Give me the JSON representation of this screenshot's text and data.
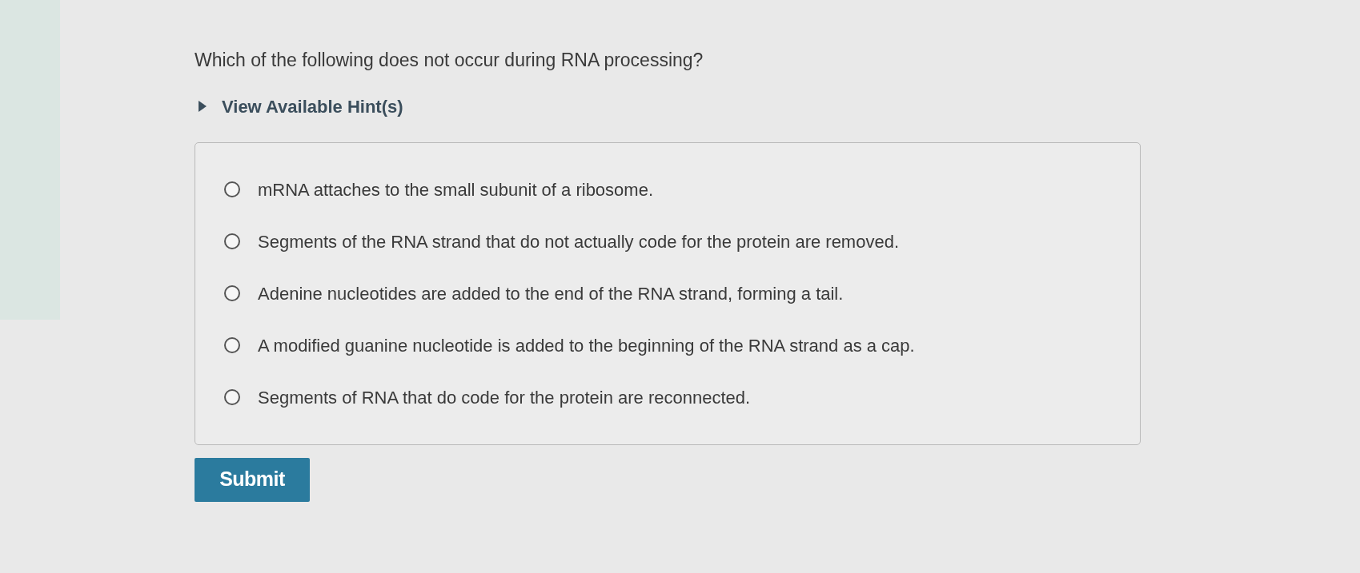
{
  "question": "Which of the following does not occur during RNA processing?",
  "hint": {
    "label": "View Available Hint(s)",
    "expanded": false
  },
  "options": [
    {
      "text": "mRNA attaches to the small subunit of a ribosome.",
      "selected": false
    },
    {
      "text": "Segments of the RNA strand that do not actually code for the protein are removed.",
      "selected": false
    },
    {
      "text": "Adenine nucleotides are added to the end of the RNA strand, forming a tail.",
      "selected": false
    },
    {
      "text": "A modified guanine nucleotide is added to the beginning of the RNA strand as a cap.",
      "selected": false
    },
    {
      "text": "Segments of RNA that do code for the protein are reconnected.",
      "selected": false
    }
  ],
  "submit": "Submit"
}
